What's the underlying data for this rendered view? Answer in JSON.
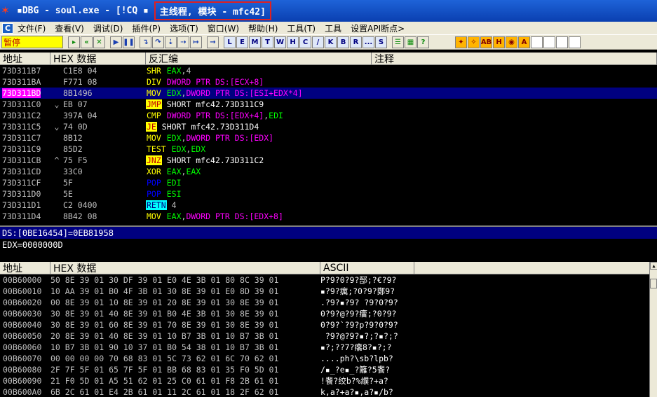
{
  "window": {
    "title": "▪DBG - soul.exe - [!CQ ▪",
    "title_highlight": "主线程, 模块 - mfc42]"
  },
  "menu": {
    "items": [
      "文件(F)",
      "查看(V)",
      "调试(D)",
      "插件(P)",
      "选项(T)",
      "窗口(W)",
      "帮助(H)",
      "工具(T)",
      "工具",
      "设置API断点>"
    ]
  },
  "toolbar": {
    "state": "暂停",
    "letters": [
      "L",
      "E",
      "M",
      "T",
      "W",
      "H",
      "C",
      "/",
      "K",
      "B",
      "R",
      "...",
      "S"
    ]
  },
  "disasm": {
    "headers": [
      "地址",
      "HEX 数据",
      "反汇编",
      "注释"
    ],
    "rows": [
      {
        "addr": "73D311B7",
        "jmp": "",
        "hex": "C1E8 04",
        "mn": "SHR",
        "cls": "mn-arith",
        "ops": [
          [
            "EAX",
            "op-reg"
          ],
          [
            ",",
            ""
          ],
          [
            "4",
            "op-num"
          ]
        ]
      },
      {
        "addr": "73D311BA",
        "jmp": "",
        "hex": "F771 08",
        "mn": "DIV",
        "cls": "mn-arith",
        "ops": [
          [
            "DWORD PTR DS:[ECX+8]",
            "op-mem"
          ]
        ]
      },
      {
        "addr": "73D311BD",
        "jmp": "",
        "hex": "8B1496",
        "mn": "MOV",
        "cls": "mn-mov",
        "sel": true,
        "ops": [
          [
            "EDX",
            "op-reg"
          ],
          [
            ",",
            ""
          ],
          [
            "DWORD PTR DS:[ESI+EDX*4]",
            "op-mem"
          ]
        ]
      },
      {
        "addr": "73D311C0",
        "jmp": "⌄",
        "hex": "EB 07",
        "mn": "JMP",
        "cls": "mn-jmp",
        "ops": [
          [
            "SHORT mfc42.73D311C9",
            "op-lbl"
          ]
        ]
      },
      {
        "addr": "73D311C2",
        "jmp": "",
        "hex": "397A 04",
        "mn": "CMP",
        "cls": "mn-arith",
        "ops": [
          [
            "DWORD PTR DS:[EDX+4]",
            "op-mem"
          ],
          [
            ",",
            ""
          ],
          [
            "EDI",
            "op-reg"
          ]
        ]
      },
      {
        "addr": "73D311C5",
        "jmp": "⌄",
        "hex": "74 0D",
        "mn": "JE",
        "cls": "mn-jmp",
        "ops": [
          [
            "SHORT mfc42.73D311D4",
            "op-lbl"
          ]
        ]
      },
      {
        "addr": "73D311C7",
        "jmp": "",
        "hex": "8B12",
        "mn": "MOV",
        "cls": "mn-mov",
        "ops": [
          [
            "EDX",
            "op-reg"
          ],
          [
            ",",
            ""
          ],
          [
            "DWORD PTR DS:[EDX]",
            "op-mem"
          ]
        ]
      },
      {
        "addr": "73D311C9",
        "jmp": "",
        "hex": "85D2",
        "mn": "TEST",
        "cls": "mn-arith",
        "ops": [
          [
            "EDX",
            "op-reg"
          ],
          [
            ",",
            ""
          ],
          [
            "EDX",
            "op-reg"
          ]
        ]
      },
      {
        "addr": "73D311CB",
        "jmp": "^",
        "hex": "75 F5",
        "mn": "JNZ",
        "cls": "mn-jmp",
        "ops": [
          [
            "SHORT mfc42.73D311C2",
            "op-lbl"
          ]
        ]
      },
      {
        "addr": "73D311CD",
        "jmp": "",
        "hex": "33C0",
        "mn": "XOR",
        "cls": "mn-arith",
        "ops": [
          [
            "EAX",
            "op-reg"
          ],
          [
            ",",
            ""
          ],
          [
            "EAX",
            "op-reg"
          ]
        ]
      },
      {
        "addr": "73D311CF",
        "jmp": "",
        "hex": "5F",
        "mn": "POP",
        "cls": "mn-stack",
        "ops": [
          [
            "EDI",
            "op-reg"
          ]
        ]
      },
      {
        "addr": "73D311D0",
        "jmp": "",
        "hex": "5E",
        "mn": "POP",
        "cls": "mn-stack",
        "ops": [
          [
            "ESI",
            "op-reg"
          ]
        ]
      },
      {
        "addr": "73D311D1",
        "jmp": "",
        "hex": "C2 0400",
        "mn": "RETN",
        "cls": "mn-ret",
        "ops": [
          [
            "4",
            "op-num"
          ]
        ]
      },
      {
        "addr": "73D311D4",
        "jmp": "",
        "hex": "8B42 08",
        "mn": "MOV",
        "cls": "mn-mov",
        "ops": [
          [
            "EAX",
            "op-reg"
          ],
          [
            ",",
            ""
          ],
          [
            "DWORD PTR DS:[EDX+8]",
            "op-mem"
          ]
        ]
      }
    ]
  },
  "info": {
    "line1": "DS:[0BE16454]=0EB81958",
    "line2": "EDX=0000000D"
  },
  "dump": {
    "headers": [
      "地址",
      "HEX 数据",
      "ASCII"
    ],
    "rows": [
      {
        "addr": "00B60000",
        "hex": "50 8E 39 01 30 DF 39 01 E0 4E 3B 01 80 8C 39 01",
        "ascii": "P?9?0?9?郚;?€?9?"
      },
      {
        "addr": "00B60010",
        "hex": "10 AA 39 01 B0 4F 3B 01 30 8E 39 01 E0 8D 39 01",
        "ascii": "▪?9?癘;?0?9?鄭9?"
      },
      {
        "addr": "00B60020",
        "hex": "00 8E 39 01 10 8E 39 01 20 8E 39 01 30 8E 39 01",
        "ascii": ".?9?▪?9? ?9?0?9?"
      },
      {
        "addr": "00B60030",
        "hex": "30 8E 39 01 40 8E 39 01 B0 4E 3B 01 30 8E 39 01",
        "ascii": "0?9?@?9?癗;?0?9?"
      },
      {
        "addr": "00B60040",
        "hex": "30 8E 39 01 60 8E 39 01 70 8E 39 01 30 8E 39 01",
        "ascii": "0?9?`?9?p?9?0?9?"
      },
      {
        "addr": "00B60050",
        "hex": "20 8E 39 01 40 8E 39 01 10 B7 3B 01 10 B7 3B 01",
        "ascii": " ?9?@?9?▪?;?▪?;?"
      },
      {
        "addr": "00B60060",
        "hex": "10 B7 3B 01 90 10 37 01 B0 54 38 01 10 B7 3B 01",
        "ascii": "▪?;??7?癟8?▪?;?"
      },
      {
        "addr": "00B60070",
        "hex": "00 00 00 00 70 68 83 01 5C 73 62 01 6C 70 62 01",
        "ascii": "....ph?\\sb?lpb?"
      },
      {
        "addr": "00B60080",
        "hex": "2F 7F 5F 01 65 7F 5F 01 BB 68 83 01 35 F0 5D 01",
        "ascii": "/▪_?e▪_?籬?5餥?"
      },
      {
        "addr": "00B60090",
        "hex": "21 F0 5D 01 A5 51 62 01 25 C0 61 01 F8 2B 61 01",
        "ascii": "!餥?绞b?%纀?+a?"
      },
      {
        "addr": "00B600A0",
        "hex": "6B 2C 61 01 E4 2B 61 01 11 2C 61 01 18 2F 62 01",
        "ascii": "k,a?+a?▪,a?▪/b?"
      }
    ]
  }
}
